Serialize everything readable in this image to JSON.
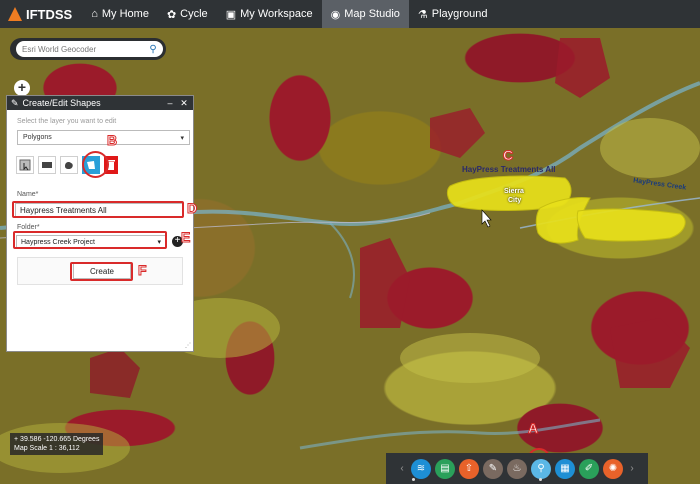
{
  "app": {
    "name": "IFTDSS"
  },
  "nav": {
    "tabs": [
      {
        "label": "My Home",
        "icon": "home-icon"
      },
      {
        "label": "Cycle",
        "icon": "cycle-icon"
      },
      {
        "label": "My Workspace",
        "icon": "folder-icon"
      },
      {
        "label": "Map Studio",
        "icon": "map-icon",
        "active": true
      },
      {
        "label": "Playground",
        "icon": "flask-icon"
      }
    ]
  },
  "geocoder": {
    "placeholder": "Esri World Geocoder"
  },
  "panel": {
    "title": "Create/Edit Shapes",
    "layer_prompt": "Select the layer you want to edit",
    "layer_value": "Polygons",
    "name_label": "Name*",
    "name_value": "Haypress Treatments All",
    "folder_label": "Folder*",
    "folder_value": "Haypress Creek Project",
    "create_label": "Create"
  },
  "map": {
    "shape_label": "HayPress Treatments All",
    "creek_label": "HayPress Creek",
    "town_label_1": "Sierra",
    "town_label_2": "City"
  },
  "coords": {
    "latlon": "39.586 -120.665 Degrees",
    "scale": "Map Scale 1 : 36,112"
  },
  "annotations": {
    "a": "A",
    "b": "B",
    "c": "C",
    "d": "D",
    "e": "E",
    "f": "F"
  },
  "colors": {
    "accent_blue": "#2a9fd8",
    "annotation_red": "#d92a2a",
    "nav_bg": "#2f3336"
  }
}
